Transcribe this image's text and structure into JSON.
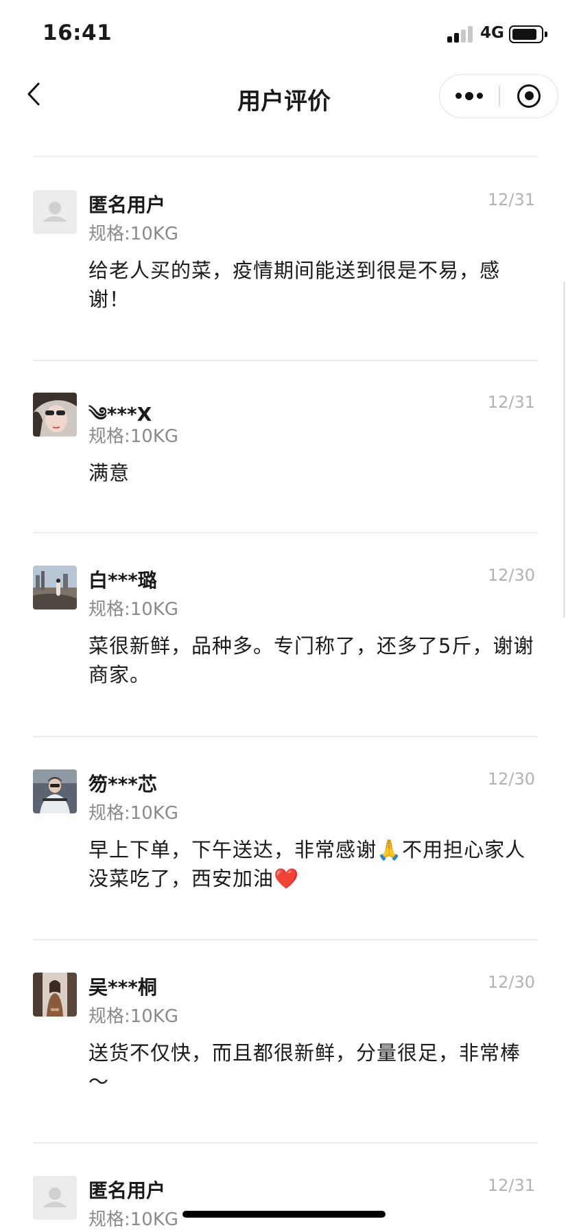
{
  "status_bar": {
    "time": "16:41",
    "network": "4G",
    "battery_level": 0.9
  },
  "nav": {
    "title": "用户评价"
  },
  "reviews": [
    {
      "name": "匿名用户",
      "date": "12/31",
      "spec": "规格:10KG",
      "content": "给老人买的菜，疫情期间能送到很是不易，感谢！"
    },
    {
      "name": "༄***X",
      "date": "12/31",
      "spec": "规格:10KG",
      "content": "满意"
    },
    {
      "name": "白***璐",
      "date": "12/30",
      "spec": "规格:10KG",
      "content": "菜很新鲜，品种多。专门称了，还多了5斤，谢谢商家。"
    },
    {
      "name": "笏***芯",
      "date": "12/30",
      "spec": "规格:10KG",
      "content": "早上下单，下午送达，非常感谢🙏不用担心家人没菜吃了，西安加油❤️"
    },
    {
      "name": "吴***桐",
      "date": "12/30",
      "spec": "规格:10KG",
      "content": "送货不仅快，而且都很新鲜，分量很足，非常棒～"
    },
    {
      "name": "匿名用户",
      "date": "12/31",
      "spec": "规格:10KG",
      "content": ""
    }
  ]
}
